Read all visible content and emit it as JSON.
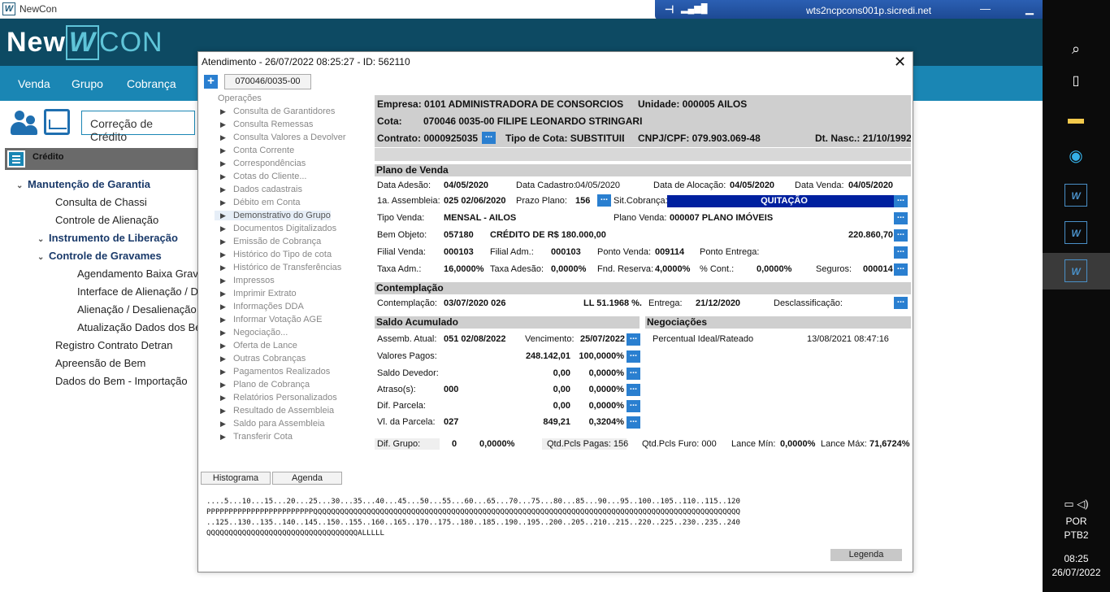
{
  "window": {
    "title": "NewCon"
  },
  "rdp": {
    "host": "wts2ncpcons001p.sicredi.net"
  },
  "brand": {
    "new": "New",
    "mark": "W",
    "con": "CON"
  },
  "nav": [
    "Venda",
    "Grupo",
    "Cobrança"
  ],
  "module": "Correção de Crédito",
  "menu": {
    "header": "Crédito",
    "items": [
      "Manutenção de Garantia",
      "Consulta de Chassi",
      "Controle de Alienação",
      "Instrumento de Liberação",
      "Controle de Gravames",
      "Agendamento Baixa Gravam",
      "Interface de Alienação / Des",
      "Alienação / Desalienação /",
      "Atualização Dados dos Ben",
      "Registro Contrato Detran",
      "Apreensão de Bem",
      "Dados do Bem - Importação"
    ]
  },
  "taskbar": {
    "lang1": "POR",
    "lang2": "PTB2",
    "time": "08:25",
    "date": "26/07/2022"
  },
  "dialog": {
    "title": "Atendimento - 26/07/2022  08:25:27 - ID: 562110",
    "cota_tab": "070046/0035-00",
    "ops_title": "Operações",
    "ops": [
      "Consulta de Garantidores",
      "Consulta Remessas",
      "Consulta Valores a Devolver",
      "Conta Corrente",
      "Correspondências",
      "Cotas do Cliente...",
      "Dados cadastrais",
      "Débito em Conta",
      "Demonstrativo do Grupo",
      "Documentos Digitalizados",
      "Emissão de Cobrança",
      "Histórico do Tipo de cota",
      "Histórico de Transferências",
      "Impressos",
      "Imprimir Extrato",
      "Informações DDA",
      "Informar Votação AGE",
      "Negociação...",
      "Oferta de Lance",
      "Outras Cobranças",
      "Pagamentos Realizados",
      "Plano de Cobrança",
      "Relatórios Personalizados",
      "Resultado de Assembleia",
      "Saldo para Assembleia",
      "Transferir Cota"
    ],
    "header": {
      "empresa": "Empresa: 0101 ADMINISTRADORA DE CONSORCIOS",
      "unidade": "Unidade: 000005 AILOS",
      "cota_label": "Cota:",
      "cota": "070046  0035-00  FILIPE LEONARDO STRINGARI",
      "contrato": "Contrato: 0000925035",
      "tipo_cota": "Tipo de Cota: SUBSTITUIDA",
      "cnpj": "CNPJ/CPF: 079.903.069-48",
      "dt_nasc": "Dt. Nasc.: 21/10/1992"
    },
    "plano": {
      "section": "Plano de Venda",
      "data_adesao_l": "Data Adesão:",
      "data_adesao": "04/05/2020",
      "data_cadastro_l": "Data Cadastro:",
      "data_cadastro": "04/05/2020",
      "data_alocacao_l": "Data de Alocação:",
      "data_alocacao": "04/05/2020",
      "data_venda_l": "Data Venda:",
      "data_venda": "04/05/2020",
      "assembleia_l": "1a. Assembleia:",
      "assembleia": "025  02/06/2020",
      "prazo_l": "Prazo Plano:",
      "prazo": "156",
      "sit_l": "Sit.Cobrança:",
      "sit": "QUITAÇÃO",
      "tipo_venda_l": "Tipo Venda:",
      "tipo_venda": "MENSAL - AILOS",
      "plano_venda_l": "Plano Venda:",
      "plano_venda": "000007     PLANO IMÓVEIS",
      "bem_l": "Bem Objeto:",
      "bem": "057180",
      "bem_desc": "CRÉDITO DE R$ 180.000,00",
      "bem_valor": "220.860,70",
      "filial_venda_l": "Filial Venda:",
      "filial_venda": "000103",
      "filial_adm_l": "Filial Adm.:",
      "filial_adm": "000103",
      "ponto_venda_l": "Ponto Venda:",
      "ponto_venda": "009114",
      "ponto_entrega_l": "Ponto Entrega:",
      "taxa_adm_l": "Taxa Adm.:",
      "taxa_adm": "16,0000%",
      "taxa_adesao_l": "Taxa Adesão:",
      "taxa_adesao": "0,0000%",
      "fnd_l": "Fnd. Reserva:",
      "fnd": "4,0000%",
      "cont_l": "% Cont.:",
      "cont": "0,0000%",
      "seguros_l": "Seguros:",
      "seguros": "000014"
    },
    "contemplacao": {
      "section": "Contemplação",
      "cont_l": "Contemplação:",
      "cont": "03/07/2020  026",
      "ll": "LL 51.1968 %.",
      "entrega_l": "Entrega:",
      "entrega": "21/12/2020",
      "desc_l": "Desclassificação:"
    },
    "saldo": {
      "section": "Saldo Acumulado",
      "assemb_l": "Assemb. Atual:",
      "assemb": "051  02/08/2022",
      "venc_l": "Vencimento:",
      "venc": "25/07/2022",
      "rows": [
        {
          "label": "Valores Pagos:",
          "a": "",
          "v": "248.142,01",
          "p": "100,0000%"
        },
        {
          "label": "Saldo Devedor:",
          "a": "",
          "v": "0,00",
          "p": "0,0000%"
        },
        {
          "label": "Atraso(s):",
          "a": "000",
          "v": "0,00",
          "p": "0,0000%"
        },
        {
          "label": "Dif. Parcela:",
          "a": "",
          "v": "0,00",
          "p": "0,0000%"
        },
        {
          "label": "Vl. da Parcela:",
          "a": "027",
          "v": "849,21",
          "p": "0,3204%"
        }
      ]
    },
    "negociacoes": {
      "section": "Negociações",
      "desc": "Percentual Ideal/Rateado",
      "date": "13/08/2021 08:47:16"
    },
    "footer": {
      "dif_l": "Dif. Grupo:",
      "dif_a": "0",
      "dif_b": "0,0000%",
      "pagas": "Qtd.Pcls Pagas: 156",
      "furo": "Qtd.Pcls Furo: 000",
      "lance_min_l": "Lance Mín:",
      "lance_min": "0,0000%",
      "lance_max_l": "Lance Máx:",
      "lance_max": "71,6724%"
    },
    "tabs": [
      "Histograma",
      "Agenda"
    ],
    "histo": [
      "....5...10...15...20...25...30...35...40...45...50...55...60...65...70...75...80...85...90...95..100..105..110..115..120",
      "PPPPPPPPPPPPPPPPPPPPPPPPQQQQQQQQQQQQQQQQQQQQQQQQQQQQQQQQQQQQQQQQQQQQQQQQQQQQQQQQQQQQQQQQQQQQQQQQQQQQQQQQQQQQQQQQQQQQQQQQ",
      "..125..130..135..140..145..150..155..160..165..170..175..180..185..190..195..200..205..210..215..220..225..230..235..240",
      "QQQQQQQQQQQQQQQQQQQQQQQQQQQQQQQQQQALLLLL"
    ],
    "legenda": "Legenda"
  }
}
